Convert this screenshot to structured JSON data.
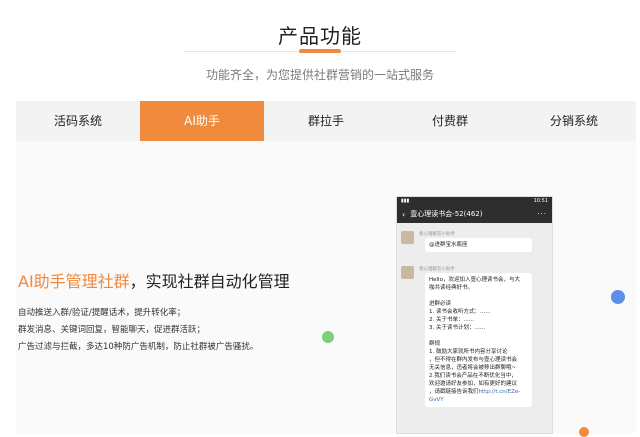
{
  "header": {
    "title": "产品功能",
    "subtitle": "功能齐全，为您提供社群营销的一站式服务"
  },
  "tabs": [
    {
      "label": "活码系统",
      "active": false
    },
    {
      "label": "AI助手",
      "active": true
    },
    {
      "label": "群拉手",
      "active": false
    },
    {
      "label": "付费群",
      "active": false
    },
    {
      "label": "分销系统",
      "active": false
    }
  ],
  "feature": {
    "title_highlight": "AI助手管理社群",
    "title_rest": "，实现社群自动化管理",
    "lines": [
      "自动推送入群/验证/提醒话术，提升转化率；",
      "群发消息、关键词回复，智能聊天，促进群活跃；",
      "广告过滤与拦截，多达10种防广告机制，防止社群被广告骚扰。"
    ]
  },
  "phone": {
    "status_time": "10:51",
    "group_name": "壹心理读书会-52(462)",
    "messages": [
      {
        "sender": "壹心理解答小助手",
        "lines": [
          "@进群宝水瓶座"
        ]
      },
      {
        "sender": "壹心理解答小助手",
        "lines": [
          "Hello，欢迎加入壹心理读书会，与大",
          "咖共读经典好书。",
          "",
          "进群必读",
          "1. 读书会收听方式：......",
          "2. 关于书单：......",
          "3. 关于读书计划：......",
          "",
          "群规",
          "1.  鼓励大家就所书内容分享讨论",
          "，但不得在群内发布与壹心理读书会",
          "无关信息，违者将会被移出群聊哦~",
          "2.我们读书会产品在不断优化当中，",
          "欢迎邀请好友参加，如有更好的建议",
          "，请戳链接告诉我们",
          "GvVY"
        ],
        "link": "http://t.cn/EZe-"
      }
    ]
  },
  "colors": {
    "accent": "#f08a3c",
    "dot_green": "#7cd07a",
    "dot_blue": "#5b8fe8",
    "dot_orange": "#f08a3c"
  }
}
